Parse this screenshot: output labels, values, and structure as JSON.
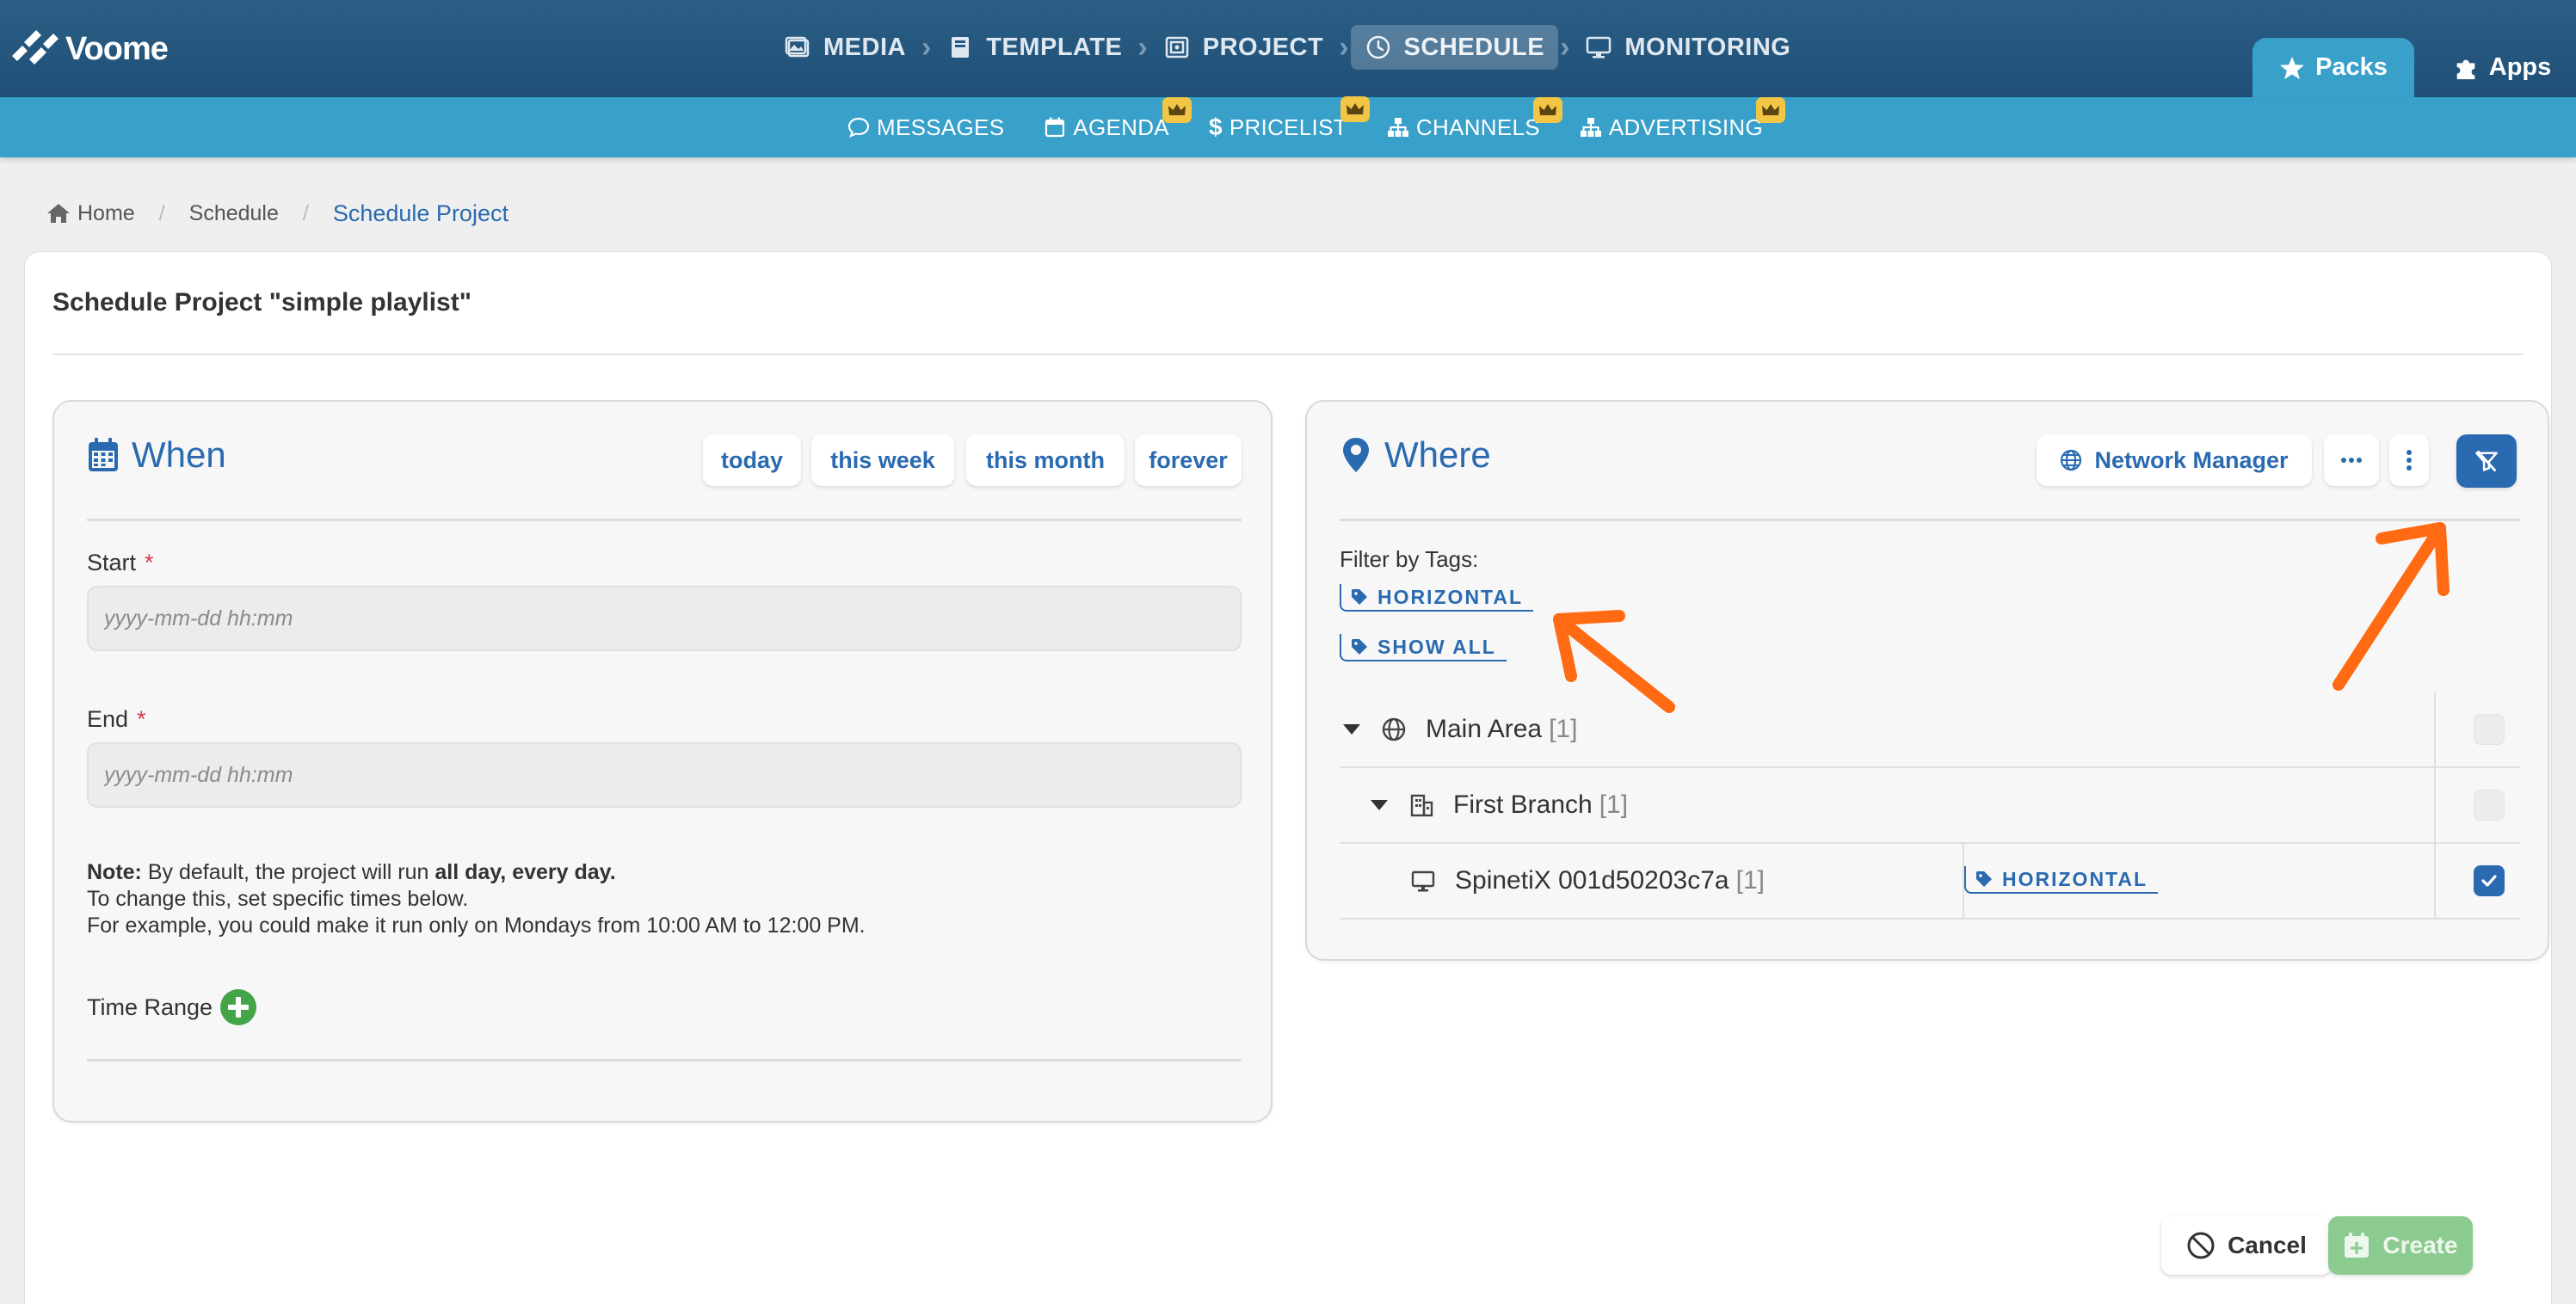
{
  "app": {
    "logo_text": "Voome"
  },
  "main_nav": [
    {
      "label": "MEDIA",
      "icon": "images-icon"
    },
    {
      "label": "TEMPLATE",
      "icon": "book-icon"
    },
    {
      "label": "PROJECT",
      "icon": "project-icon"
    },
    {
      "label": "SCHEDULE",
      "icon": "clock-icon",
      "active": true
    },
    {
      "label": "MONITORING",
      "icon": "monitor-icon"
    }
  ],
  "top_tabs": {
    "packs": "Packs",
    "apps": "Apps"
  },
  "sub_nav": [
    {
      "label": "MESSAGES",
      "icon": "comment-icon",
      "premium": false
    },
    {
      "label": "AGENDA",
      "icon": "calendar-icon",
      "premium": true
    },
    {
      "label": "PRICELIST",
      "icon": "dollar-icon",
      "premium": true
    },
    {
      "label": "CHANNELS",
      "icon": "sitemap-icon",
      "premium": true
    },
    {
      "label": "ADVERTISING",
      "icon": "sitemap-icon",
      "premium": true
    }
  ],
  "breadcrumb": {
    "home": "Home",
    "schedule": "Schedule",
    "current": "Schedule Project"
  },
  "page": {
    "title": "Schedule Project \"simple playlist\""
  },
  "when": {
    "heading": "When",
    "quick": {
      "today": "today",
      "this_week": "this week",
      "this_month": "this month",
      "forever": "forever"
    },
    "start_label": "Start",
    "start_placeholder": "yyyy-mm-dd hh:mm",
    "end_label": "End",
    "end_placeholder": "yyyy-mm-dd hh:mm",
    "required_mark": "*",
    "note": {
      "prefix": "Note:",
      "line1_a": " By default, the project will run ",
      "line1_b": "all day, every day.",
      "line2": "To change this, set specific times below.",
      "line3": "For example, you could make it run only on Mondays from 10:00 AM to 12:00 PM."
    },
    "time_range_label": "Time Range"
  },
  "where": {
    "heading": "Where",
    "network_manager": "Network Manager",
    "filter_label": "Filter by Tags:",
    "tags": [
      "HORIZONTAL",
      "SHOW ALL"
    ],
    "tree": [
      {
        "name": "Main Area",
        "count": "[1]",
        "checked": false
      },
      {
        "name": "First Branch",
        "count": "[1]",
        "checked": false
      },
      {
        "name": "SpinetiX 001d50203c7a",
        "count": "[1]",
        "tag": "HORIZONTAL",
        "checked": true
      }
    ]
  },
  "footer": {
    "cancel": "Cancel",
    "create": "Create"
  },
  "colors": {
    "header": "#245882",
    "subbar": "#38a0c9",
    "accent": "#2a6ab0",
    "premium": "#f3c545",
    "create": "#8ccb8f",
    "annotation": "#ff6a13"
  }
}
